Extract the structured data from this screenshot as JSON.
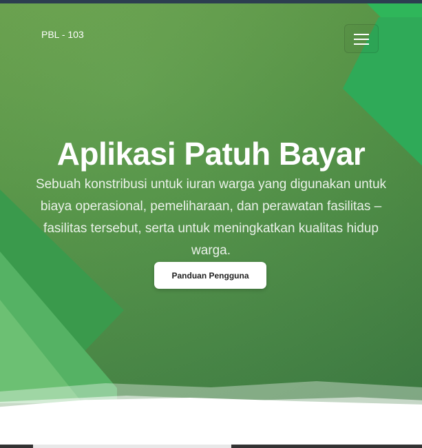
{
  "navbar": {
    "brand": "PBL - 103",
    "menu_icon": "hamburger-menu-icon"
  },
  "hero": {
    "title": "Aplikasi Patuh Bayar",
    "description": "Sebuah konstribusi untuk iuran warga yang digunakan untuk biaya operasional, pemeliharaan, dan perawatan fasilitas – fasilitas tersebut, serta untuk meningkatkan kualitas hidup warga.",
    "cta_label": "Panduan Pengguna"
  },
  "colors": {
    "hero_primary": "#539544",
    "accent": "#2faa58",
    "button_bg": "#ffffff"
  }
}
